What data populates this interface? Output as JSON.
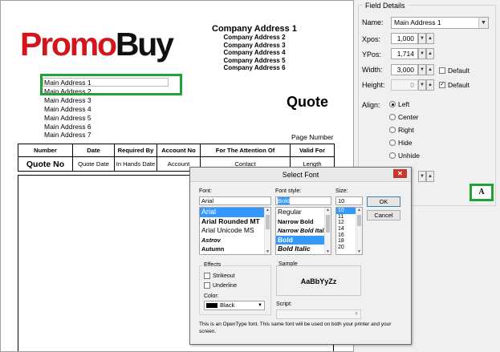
{
  "report": {
    "logo": {
      "part1": "Promo",
      "part2": "Buy"
    },
    "company_address": [
      "Company Address 1",
      "Company Address 2",
      "Company Address 3",
      "Company Address 4",
      "Company Address 5",
      "Company Address 6"
    ],
    "main_address": [
      "Main Address 1",
      "Main Address 2",
      "Main Address 3",
      "Main Address 4",
      "Main Address 5",
      "Main Address 6",
      "Main Address 7"
    ],
    "title": "Quote",
    "page_number": "Page Number",
    "table": {
      "headers": [
        "Number",
        "Date",
        "Required By",
        "Account No",
        "For The Attention Of",
        "Valid For"
      ],
      "values": [
        "Quote No",
        "Quote Date",
        "In Hands Date",
        "Account",
        "Contact",
        "Length"
      ]
    }
  },
  "field_details": {
    "title": "Field Details",
    "name_label": "Name:",
    "name_value": "Main Address 1",
    "xpos_label": "Xpos:",
    "xpos_value": "1,000",
    "ypos_label": "YPos:",
    "ypos_value": "1,714",
    "width_label": "Width:",
    "width_value": "3,000",
    "width_default_label": "Default",
    "width_default_checked": false,
    "height_label": "Height:",
    "height_value": "0",
    "height_default_label": "Default",
    "height_default_checked": true,
    "align_label": "Align:",
    "align_options": [
      "Left",
      "Center",
      "Right",
      "Hide",
      "Unhide"
    ],
    "align_selected": "Left",
    "font_button_label": "A"
  },
  "select_font_dialog": {
    "title": "Select Font",
    "font_label": "Font:",
    "font_value": "Arial",
    "fonts": [
      "Arial",
      "Arial Rounded MT",
      "Arial Unicode MS",
      "Astrov",
      "Autumn"
    ],
    "style_label": "Font style:",
    "style_value": "Bold",
    "styles": [
      "Regular",
      "Narrow Bold",
      "Narrow Bold Italic",
      "Bold",
      "Bold Italic"
    ],
    "size_label": "Size:",
    "size_value": "10",
    "sizes": [
      "10",
      "11",
      "12",
      "14",
      "16",
      "18",
      "20"
    ],
    "ok_label": "OK",
    "cancel_label": "Cancel",
    "effects_label": "Effects",
    "strikeout_label": "Strikeout",
    "underline_label": "Underline",
    "color_label": "Color:",
    "color_value": "Black",
    "sample_label": "Sample",
    "sample_text": "AaBbYyZz",
    "script_label": "Script:",
    "note": "This is an OpenType font. This same font will be used on both your printer and your screen."
  }
}
